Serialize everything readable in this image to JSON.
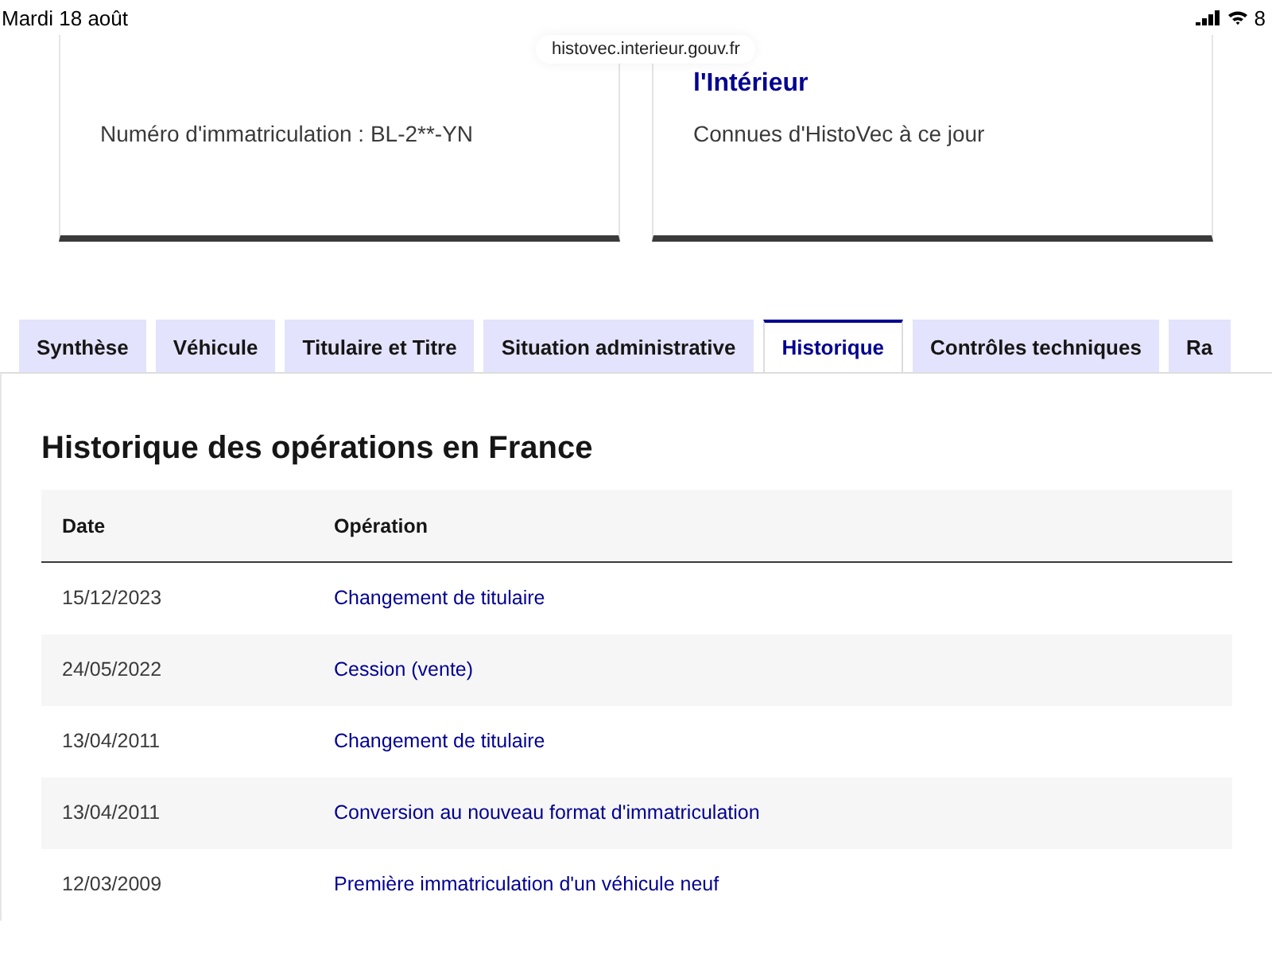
{
  "status_bar": {
    "date": "Mardi 18 août",
    "battery": "8"
  },
  "url_bar": {
    "address": "histovec.interieur.gouv.fr"
  },
  "cards": [
    {
      "text": "Numéro d'immatriculation : BL-2**-YN"
    },
    {
      "title": "l'Intérieur",
      "text": "Connues d'HistoVec à ce jour"
    }
  ],
  "tabs": [
    {
      "label": "Synthèse",
      "selected": false
    },
    {
      "label": "Véhicule",
      "selected": false
    },
    {
      "label": "Titulaire et Titre",
      "selected": false
    },
    {
      "label": "Situation administrative",
      "selected": false
    },
    {
      "label": "Historique",
      "selected": true
    },
    {
      "label": "Contrôles techniques",
      "selected": false
    },
    {
      "label": "Ra",
      "selected": false
    }
  ],
  "section": {
    "title": "Historique des opérations en France"
  },
  "table": {
    "columns": [
      "Date",
      "Opération"
    ],
    "rows": [
      [
        "15/12/2023",
        "Changement de titulaire"
      ],
      [
        "24/05/2022",
        "Cession (vente)"
      ],
      [
        "13/04/2011",
        "Changement de titulaire"
      ],
      [
        "13/04/2011",
        "Conversion au nouveau format d'immatriculation"
      ],
      [
        "12/03/2009",
        "Première immatriculation d'un véhicule neuf"
      ]
    ]
  }
}
